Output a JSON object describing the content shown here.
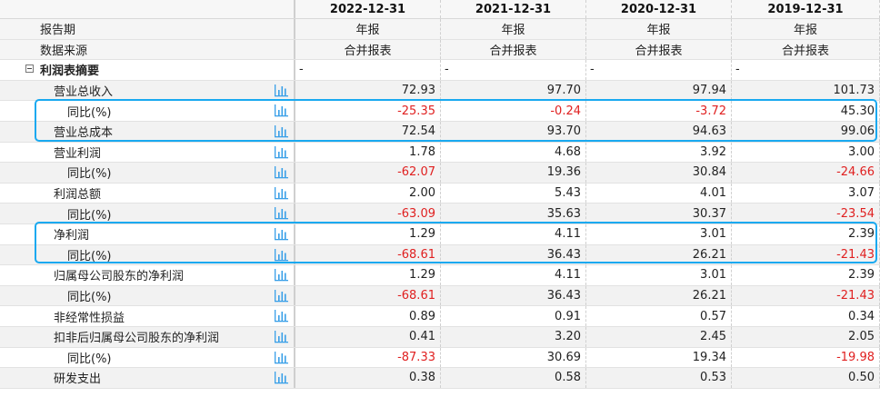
{
  "header": {
    "periods": [
      "2022-12-31",
      "2021-12-31",
      "2020-12-31",
      "2019-12-31"
    ]
  },
  "meta_rows": [
    {
      "label": "报告期",
      "values": [
        "年报",
        "年报",
        "年报",
        "年报"
      ]
    },
    {
      "label": "数据来源",
      "values": [
        "合并报表",
        "合并报表",
        "合并报表",
        "合并报表"
      ]
    }
  ],
  "section": {
    "label": "利润表摘要",
    "values": [
      "-",
      "-",
      "-",
      "-"
    ],
    "toggle_icon": "collapse-minus-icon"
  },
  "rows": [
    {
      "label": "营业总收入",
      "values": [
        "72.93",
        "97.70",
        "97.94",
        "101.73"
      ]
    },
    {
      "label": "同比(%)",
      "values": [
        "-25.35",
        "-0.24",
        "-3.72",
        "45.30"
      ]
    },
    {
      "label": "营业总成本",
      "values": [
        "72.54",
        "93.70",
        "94.63",
        "99.06"
      ]
    },
    {
      "label": "营业利润",
      "values": [
        "1.78",
        "4.68",
        "3.92",
        "3.00"
      ]
    },
    {
      "label": "同比(%)",
      "values": [
        "-62.07",
        "19.36",
        "30.84",
        "-24.66"
      ]
    },
    {
      "label": "利润总额",
      "values": [
        "2.00",
        "5.43",
        "4.01",
        "3.07"
      ]
    },
    {
      "label": "同比(%)",
      "values": [
        "-63.09",
        "35.63",
        "30.37",
        "-23.54"
      ]
    },
    {
      "label": "净利润",
      "values": [
        "1.29",
        "4.11",
        "3.01",
        "2.39"
      ]
    },
    {
      "label": "同比(%)",
      "values": [
        "-68.61",
        "36.43",
        "26.21",
        "-21.43"
      ]
    },
    {
      "label": "归属母公司股东的净利润",
      "values": [
        "1.29",
        "4.11",
        "3.01",
        "2.39"
      ]
    },
    {
      "label": "同比(%)",
      "values": [
        "-68.61",
        "36.43",
        "26.21",
        "-21.43"
      ]
    },
    {
      "label": "非经常性损益",
      "values": [
        "0.89",
        "0.91",
        "0.57",
        "0.34"
      ]
    },
    {
      "label": "扣非后归属母公司股东的净利润",
      "values": [
        "0.41",
        "3.20",
        "2.45",
        "2.05"
      ]
    },
    {
      "label": "同比(%)",
      "values": [
        "-87.33",
        "30.69",
        "19.34",
        "-19.98"
      ]
    },
    {
      "label": "研发支出",
      "values": [
        "0.38",
        "0.58",
        "0.53",
        "0.50"
      ]
    }
  ],
  "colors": {
    "negative": "#e02020",
    "highlight_border": "#19a9f0",
    "chart_icon": "#3aa0e8"
  },
  "icons": {
    "row_chart": "bar-chart-icon"
  }
}
